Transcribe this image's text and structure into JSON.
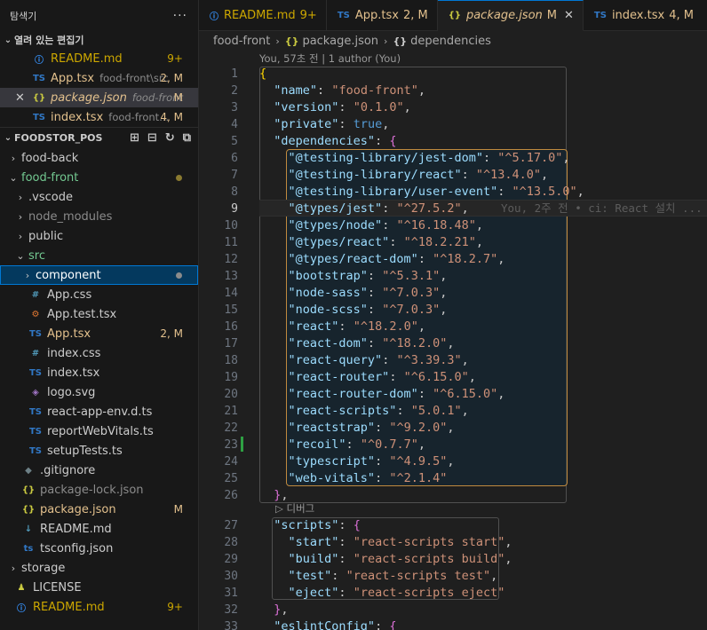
{
  "sidebar": {
    "title": "탐색기",
    "more": "···",
    "open_editors_title": "열려 있는 편집기",
    "open_editors": [
      {
        "icon": "ⓘ",
        "icon_type": "info",
        "label": "README.md",
        "desc": "",
        "badge": "9+"
      },
      {
        "icon": "TS",
        "icon_type": "ts",
        "label": "App.tsx",
        "desc": "food-front\\src",
        "badge": "2, M"
      },
      {
        "icon": "{}",
        "icon_type": "json",
        "label": "package.json",
        "desc": "food-front",
        "badge": "M"
      },
      {
        "icon": "TS",
        "icon_type": "ts",
        "label": "index.tsx",
        "desc": "food-front...",
        "badge": "4, M"
      }
    ],
    "project_title": "FOODSTOR_POS",
    "tree": [
      {
        "label": "food-back",
        "kind": "folder"
      },
      {
        "label": "food-front",
        "kind": "folder-open"
      },
      {
        "label": ".vscode",
        "kind": "folder"
      },
      {
        "label": "node_modules",
        "kind": "folder"
      },
      {
        "label": "public",
        "kind": "folder"
      },
      {
        "label": "src",
        "kind": "folder-open"
      },
      {
        "label": "component",
        "kind": "folder"
      },
      {
        "label": "App.css",
        "icon": "#"
      },
      {
        "label": "App.test.tsx",
        "icon": "⚙"
      },
      {
        "label": "App.tsx",
        "icon": "TS",
        "badge": "2, M"
      },
      {
        "label": "index.css",
        "icon": "#"
      },
      {
        "label": "index.tsx",
        "icon": "TS"
      },
      {
        "label": "logo.svg",
        "icon": "◈"
      },
      {
        "label": "react-app-env.d.ts",
        "icon": "TS"
      },
      {
        "label": "reportWebVitals.ts",
        "icon": "TS"
      },
      {
        "label": "setupTests.ts",
        "icon": "TS"
      },
      {
        "label": ".gitignore",
        "icon": "◆"
      },
      {
        "label": "package-lock.json",
        "icon": "{}"
      },
      {
        "label": "package.json",
        "icon": "{}",
        "badge": "M"
      },
      {
        "label": "README.md",
        "icon": "↓"
      },
      {
        "label": "tsconfig.json",
        "icon": "ts"
      },
      {
        "label": "storage",
        "kind": "folder"
      },
      {
        "label": "LICENSE",
        "icon": "♟"
      },
      {
        "label": "README.md",
        "icon": "ⓘ",
        "badge": "9+"
      }
    ]
  },
  "tabs": [
    {
      "icon": "ⓘ",
      "label": "README.md",
      "badge": "9+"
    },
    {
      "icon": "TS",
      "label": "App.tsx",
      "badge": "2, M"
    },
    {
      "icon": "{}",
      "label": "package.json",
      "badge": "M",
      "close": "✕"
    },
    {
      "icon": "TS",
      "label": "index.tsx",
      "badge": "4, M"
    }
  ],
  "breadcrumb": {
    "folder": "food-front",
    "file": "package.json",
    "symbol": "dependencies",
    "sep": "›"
  },
  "editor": {
    "codelens": "You, 57초 전 | 1 author (You)",
    "debug_lens": "▷ 디버그",
    "current_line": 9,
    "blame": "You, 2주 전 • ci: React 설치 ...",
    "lines1": [
      {
        "n": 1,
        "t": "{"
      },
      {
        "n": 2,
        "t": "  \"name\": \"food-front\","
      },
      {
        "n": 3,
        "t": "  \"version\": \"0.1.0\","
      },
      {
        "n": 4,
        "t": "  \"private\": true,"
      },
      {
        "n": 5,
        "t": "  \"dependencies\": {"
      },
      {
        "n": 6,
        "t": "    \"@testing-library/jest-dom\": \"^5.17.0\","
      },
      {
        "n": 7,
        "t": "    \"@testing-library/react\": \"^13.4.0\","
      },
      {
        "n": 8,
        "t": "    \"@testing-library/user-event\": \"^13.5.0\","
      },
      {
        "n": 9,
        "t": "    \"@types/jest\": \"^27.5.2\","
      },
      {
        "n": 10,
        "t": "    \"@types/node\": \"^16.18.48\","
      },
      {
        "n": 11,
        "t": "    \"@types/react\": \"^18.2.21\","
      },
      {
        "n": 12,
        "t": "    \"@types/react-dom\": \"^18.2.7\","
      },
      {
        "n": 13,
        "t": "    \"bootstrap\": \"^5.3.1\","
      },
      {
        "n": 14,
        "t": "    \"node-sass\": \"^7.0.3\","
      },
      {
        "n": 15,
        "t": "    \"node-scss\": \"^7.0.3\","
      },
      {
        "n": 16,
        "t": "    \"react\": \"^18.2.0\","
      },
      {
        "n": 17,
        "t": "    \"react-dom\": \"^18.2.0\","
      },
      {
        "n": 18,
        "t": "    \"react-query\": \"^3.39.3\","
      },
      {
        "n": 19,
        "t": "    \"react-router\": \"^6.15.0\","
      },
      {
        "n": 20,
        "t": "    \"react-router-dom\": \"^6.15.0\","
      },
      {
        "n": 21,
        "t": "    \"react-scripts\": \"5.0.1\","
      },
      {
        "n": 22,
        "t": "    \"reactstrap\": \"^9.2.0\","
      },
      {
        "n": 23,
        "t": "    \"recoil\": \"^0.7.7\","
      },
      {
        "n": 24,
        "t": "    \"typescript\": \"^4.9.5\","
      },
      {
        "n": 25,
        "t": "    \"web-vitals\": \"^2.1.4\""
      },
      {
        "n": 26,
        "t": "  },"
      }
    ],
    "lines2": [
      {
        "n": 27,
        "t": "  \"scripts\": {"
      },
      {
        "n": 28,
        "t": "    \"start\": \"react-scripts start\","
      },
      {
        "n": 29,
        "t": "    \"build\": \"react-scripts build\","
      },
      {
        "n": 30,
        "t": "    \"test\": \"react-scripts test\","
      },
      {
        "n": 31,
        "t": "    \"eject\": \"react-scripts eject\""
      },
      {
        "n": 32,
        "t": "  },"
      },
      {
        "n": 33,
        "t": "  \"eslintConfig\": {"
      }
    ]
  }
}
